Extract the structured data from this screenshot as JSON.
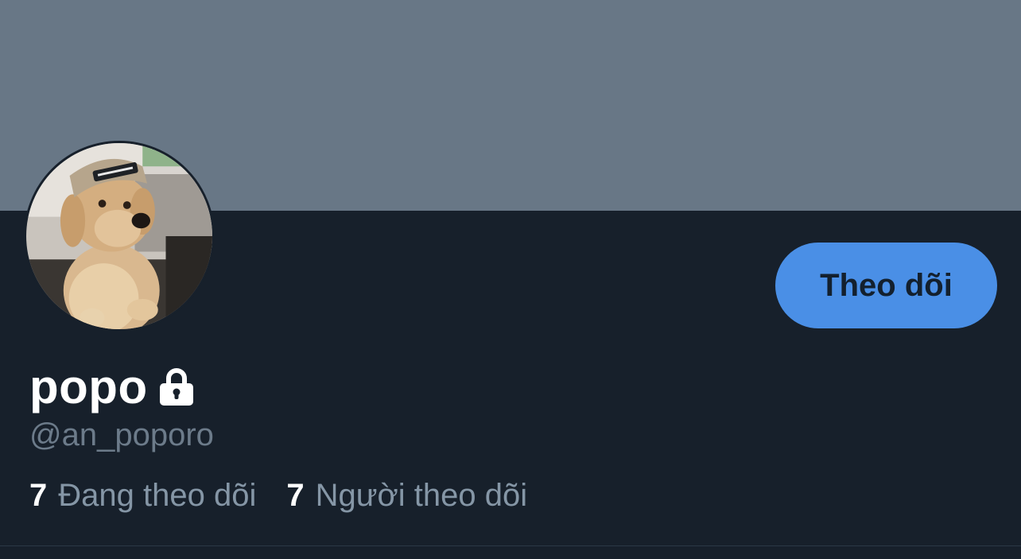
{
  "profile": {
    "display_name": "popo",
    "handle": "@an_poporo",
    "protected_icon": "lock-icon",
    "avatar": "golden-retriever-puppy-in-cap-photo"
  },
  "actions": {
    "follow_label": "Theo dõi"
  },
  "stats": {
    "following_count": "7",
    "following_label": "Đang theo dõi",
    "followers_count": "7",
    "followers_label": "Người theo dõi"
  },
  "colors": {
    "background": "#17202b",
    "banner": "#687786",
    "accent": "#4a8fe6",
    "secondary_text": "#8596a6"
  }
}
